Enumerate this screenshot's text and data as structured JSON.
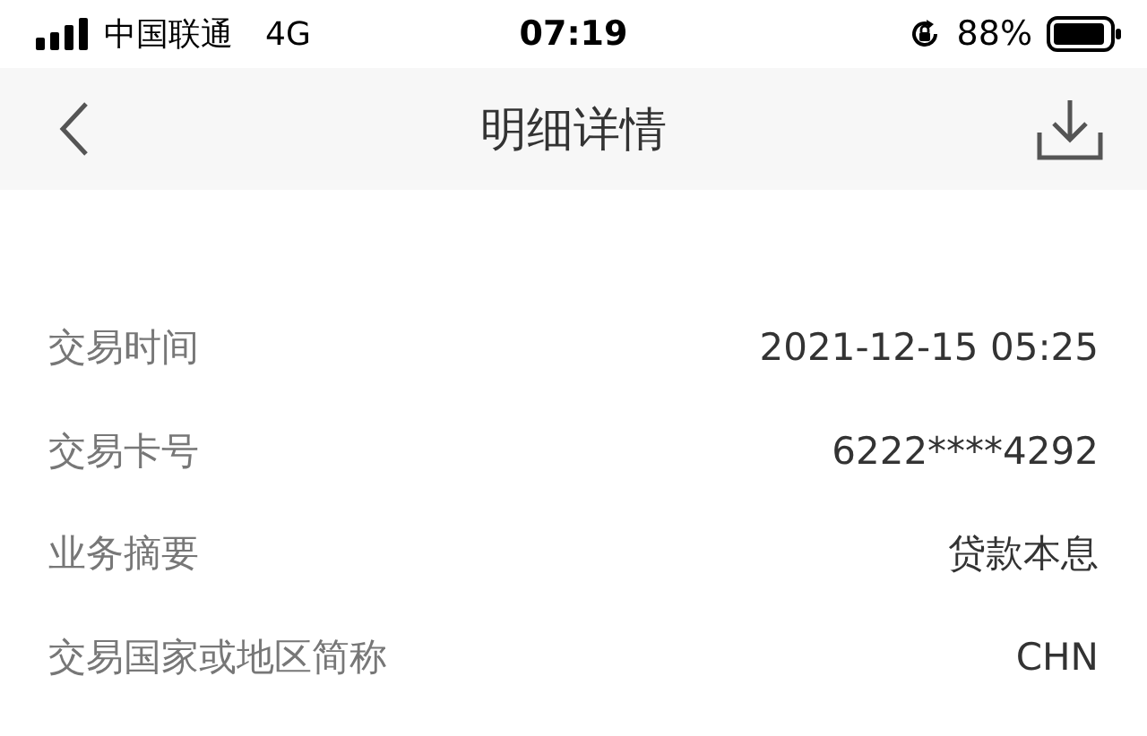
{
  "status_bar": {
    "carrier": "中国联通",
    "network": "4G",
    "time": "07:19",
    "battery_percent": "88%"
  },
  "nav_bar": {
    "title": "明细详情"
  },
  "details": [
    {
      "label": "交易时间",
      "value": "2021-12-15 05:25"
    },
    {
      "label": "交易卡号",
      "value": "6222****4292"
    },
    {
      "label": "业务摘要",
      "value": "贷款本息"
    },
    {
      "label": "交易国家或地区简称",
      "value": "CHN"
    }
  ]
}
